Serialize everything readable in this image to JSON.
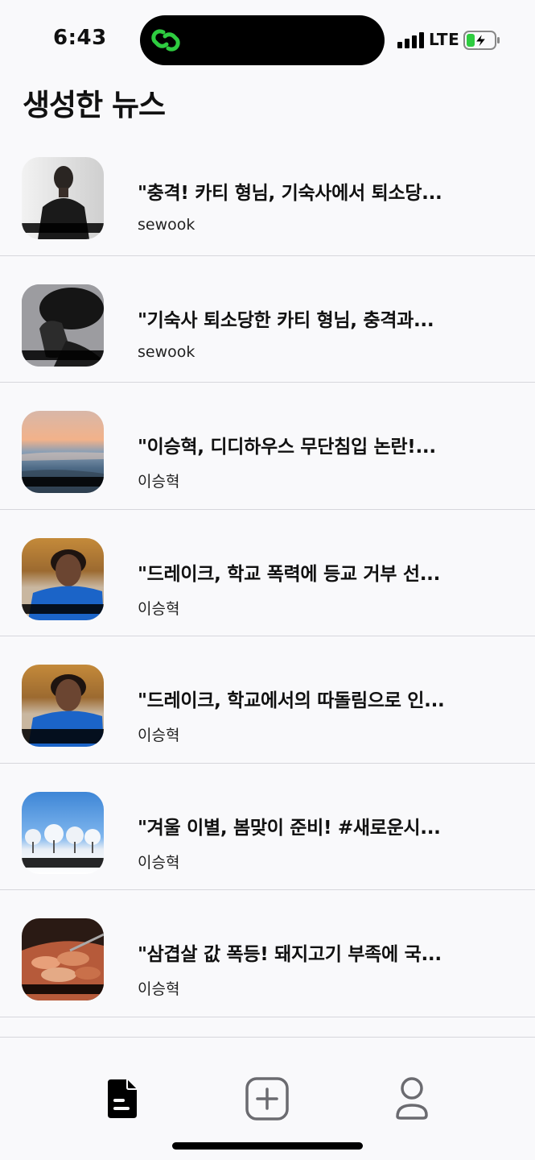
{
  "status_bar": {
    "time": "6:43",
    "network": "LTE",
    "island_icon": "link-icon",
    "accent_color": "#2ecc40"
  },
  "page": {
    "title": "생성한 뉴스"
  },
  "news": [
    {
      "title": "\"충격! 카티 형님, 기숙사에서 퇴소당...",
      "author": "sewook",
      "thumb": "person-portrait-gray"
    },
    {
      "title": "\"기숙사 퇴소당한 카티 형님, 충격과...",
      "author": "sewook",
      "thumb": "person-profile-dark"
    },
    {
      "title": "\"이승혁, 디디하우스 무단침입 논란!...",
      "author": "이승혁",
      "thumb": "sunset-sea"
    },
    {
      "title": "\"드레이크, 학교 폭력에 등교 거부 선...",
      "author": "이승혁",
      "thumb": "man-blue-shirt"
    },
    {
      "title": "\"드레이크, 학교에서의 따돌림으로 인...",
      "author": "이승혁",
      "thumb": "man-blue-shirt"
    },
    {
      "title": "\"겨울 이별, 봄맞이 준비! #새로운시...",
      "author": "이승혁",
      "thumb": "winter-trees"
    },
    {
      "title": "\"삼겹살 값 폭등! 돼지고기 부족에 국...",
      "author": "이승혁",
      "thumb": "grilled-pork"
    }
  ],
  "tab_bar": {
    "tabs": [
      {
        "name": "news-tab",
        "icon": "document-icon",
        "active": true
      },
      {
        "name": "create-tab",
        "icon": "plus-square-icon",
        "active": false
      },
      {
        "name": "profile-tab",
        "icon": "person-icon",
        "active": false
      }
    ]
  }
}
